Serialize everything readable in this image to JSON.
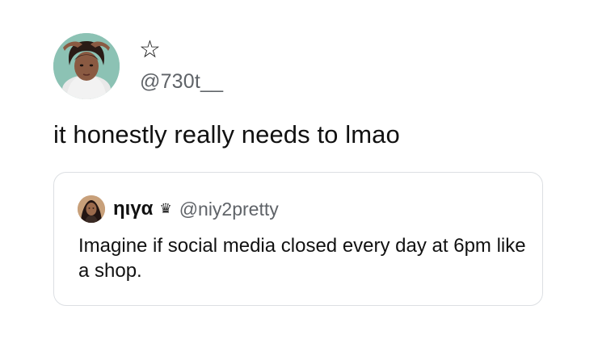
{
  "tweet": {
    "display_name": "☆",
    "handle": "@730t__",
    "text": "it honestly really needs to lmao",
    "avatar_icon": "profile-photo-avatar"
  },
  "quoted_tweet": {
    "display_name": "ηιγα",
    "badge": "♛",
    "handle": "@niy2pretty",
    "text": "Imagine if social media closed every day at 6pm like a shop.",
    "avatar_icon": "profile-photo-avatar"
  },
  "colors": {
    "text_primary": "#111111",
    "text_secondary": "#5f6368",
    "card_border": "#dcdfe3",
    "background": "#ffffff"
  }
}
